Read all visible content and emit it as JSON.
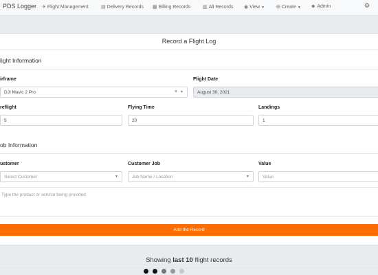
{
  "nav": {
    "brand": "PDS Logger",
    "items": [
      {
        "label": "Flight Management",
        "icon": "plane-icon"
      },
      {
        "label": "Delivery Records",
        "icon": "document-icon"
      },
      {
        "label": "Billing Records",
        "icon": "billing-icon"
      },
      {
        "label": "All Records",
        "icon": "bar-chart-icon"
      },
      {
        "label": "View",
        "icon": "eye-icon"
      },
      {
        "label": "Create",
        "icon": "plus-square-icon"
      },
      {
        "label": "Admin",
        "icon": "user-cog-icon"
      }
    ],
    "settings_icon": "gear-icon"
  },
  "form": {
    "title": "Record a Flight Log",
    "flight_section": "light Information",
    "airframe_label": "irframe",
    "airframe_value": "DJI Mavic 2 Pro",
    "flight_date_label": "Flight Date",
    "flight_date_value": "August 30, 2021",
    "preflight_label": "reflight",
    "preflight_value": "5",
    "flying_time_label": "Flying Time",
    "flying_time_value": "20",
    "landings_label": "Landings",
    "landings_value": "1",
    "job_section": "ob Information",
    "customer_label": "ustomer",
    "customer_placeholder": "Select Customer",
    "customer_job_label": "Customer Job",
    "customer_job_placeholder": "Job Name / Location",
    "value_label": "Value",
    "value_placeholder": "Value",
    "product_placeholder": "Type the product or service being provided",
    "submit_label": "Add the Record"
  },
  "records": {
    "prefix": "Showing ",
    "bold": "last 10",
    "suffix": " flight records"
  },
  "colors": {
    "accent": "#ff6d00",
    "dots": [
      "#111111",
      "#111111",
      "#777777",
      "#999999",
      "#c8c8c8"
    ]
  }
}
